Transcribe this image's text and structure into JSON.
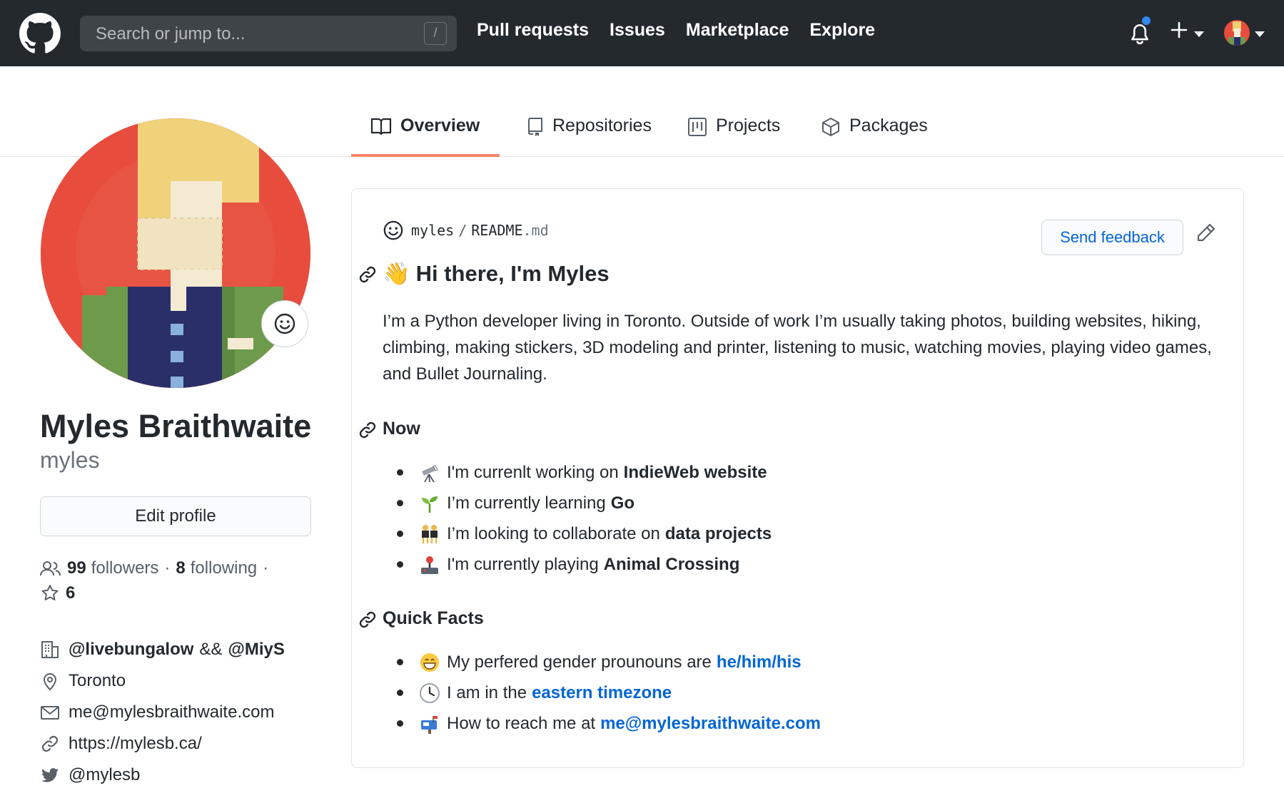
{
  "header": {
    "search_placeholder": "Search or jump to...",
    "slash_hint": "/",
    "nav": [
      "Pull requests",
      "Issues",
      "Marketplace",
      "Explore"
    ]
  },
  "tabs": [
    "Overview",
    "Repositories",
    "Projects",
    "Packages"
  ],
  "profile": {
    "full_name": "Myles Braithwaite",
    "username": "myles",
    "edit_label": "Edit profile",
    "followers_count": "99",
    "followers_label": "followers",
    "dot1": "·",
    "following_count": "8",
    "following_label": "following",
    "dot2": "·",
    "stars_count": "6",
    "org_1": "@livebungalow",
    "org_sep": "&&",
    "org_2": "@MiyS",
    "location": "Toronto",
    "email": "me@mylesbraithwaite.com",
    "website": "https://mylesb.ca/",
    "twitter": "@mylesb"
  },
  "readme": {
    "repo": "myles",
    "sep": "/",
    "file_base": "README",
    "file_ext": ".md",
    "feedback_label": "Send feedback",
    "heading_emoji": "👋",
    "heading": "Hi there, I'm Myles",
    "intro": "I’m a Python developer living in Toronto. Outside of work I’m usually taking photos, building websites, hiking, climbing, making stickers, 3D modeling and printer, listening to music, watching movies, playing video games, and Bullet Journaling.",
    "now_heading": "Now",
    "now_items": [
      {
        "icon": "telescope-emoji",
        "text": "I'm currenlt working on",
        "bold": "IndieWeb website"
      },
      {
        "icon": "seedling-emoji",
        "text": "I’m currently learning",
        "bold": "Go"
      },
      {
        "icon": "dancers-emoji",
        "text": "I’m looking to collaborate on",
        "bold": "data projects"
      },
      {
        "icon": "joystick-emoji",
        "text": "I'm currently playing",
        "bold": "Animal Crossing"
      }
    ],
    "facts_heading": "Quick Facts",
    "fact_items": [
      {
        "icon": "grinning-face-emoji",
        "text": "My perfered gender prounouns are",
        "link": "he/him/his"
      },
      {
        "icon": "clock-emoji",
        "text": "I am in the",
        "link": "eastern timezone"
      },
      {
        "icon": "mailbox-emoji",
        "text": "How to reach me at",
        "link": "me@mylesbraithwaite.com"
      }
    ]
  },
  "colors": {
    "header_bg": "#24292e",
    "accent_tab_underline": "#f9826c",
    "link_blue": "#0366d6",
    "notification_dot": "#3388ee"
  }
}
